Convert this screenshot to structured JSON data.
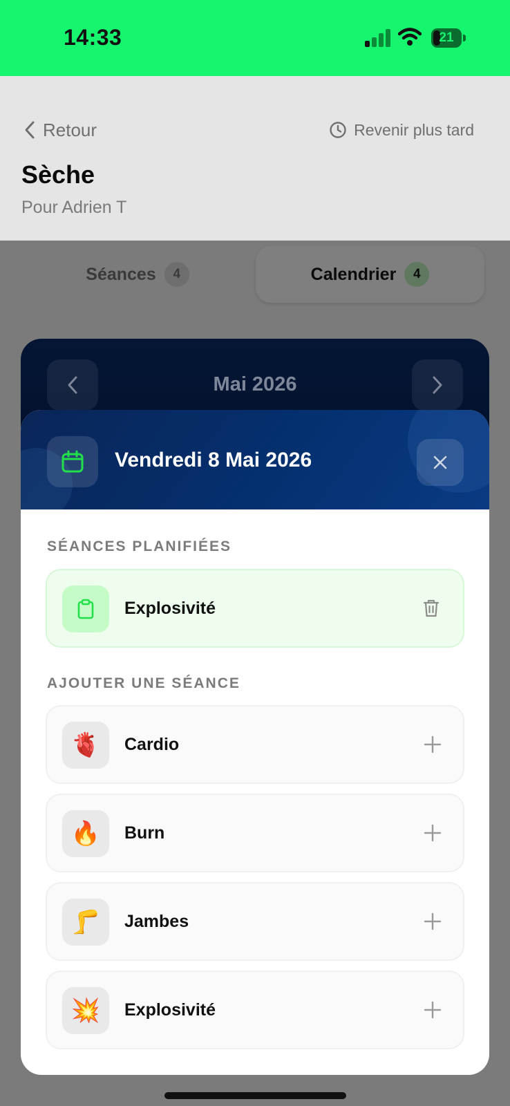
{
  "status_bar": {
    "time": "14:33",
    "battery_level": "21",
    "background": "#15f56e"
  },
  "header": {
    "back_label": "Retour",
    "later_label": "Revenir plus tard",
    "title": "Sèche",
    "subtitle": "Pour Adrien T"
  },
  "tabs": [
    {
      "label": "Séances",
      "count": "4",
      "selected": false
    },
    {
      "label": "Calendrier",
      "count": "4",
      "selected": true
    }
  ],
  "calendar": {
    "month_label": "Mai 2026"
  },
  "sheet": {
    "date_title": "Vendredi 8 Mai 2026",
    "planned_heading": "SÉANCES PLANIFIÉES",
    "planned": [
      {
        "label": "Explosivité",
        "icon": "clipboard-icon"
      }
    ],
    "add_heading": "AJOUTER UNE SÉANCE",
    "add_options": [
      {
        "label": "Cardio",
        "icon": "🫀",
        "icon_name": "anatomical-heart-icon"
      },
      {
        "label": "Burn",
        "icon": "🔥",
        "icon_name": "fire-icon"
      },
      {
        "label": "Jambes",
        "icon": "🦵",
        "icon_name": "leg-icon"
      },
      {
        "label": "Explosivité",
        "icon": "💥",
        "icon_name": "collision-icon"
      }
    ]
  },
  "colors": {
    "accent_green": "#22e04a",
    "header_blue": "#04306f"
  }
}
